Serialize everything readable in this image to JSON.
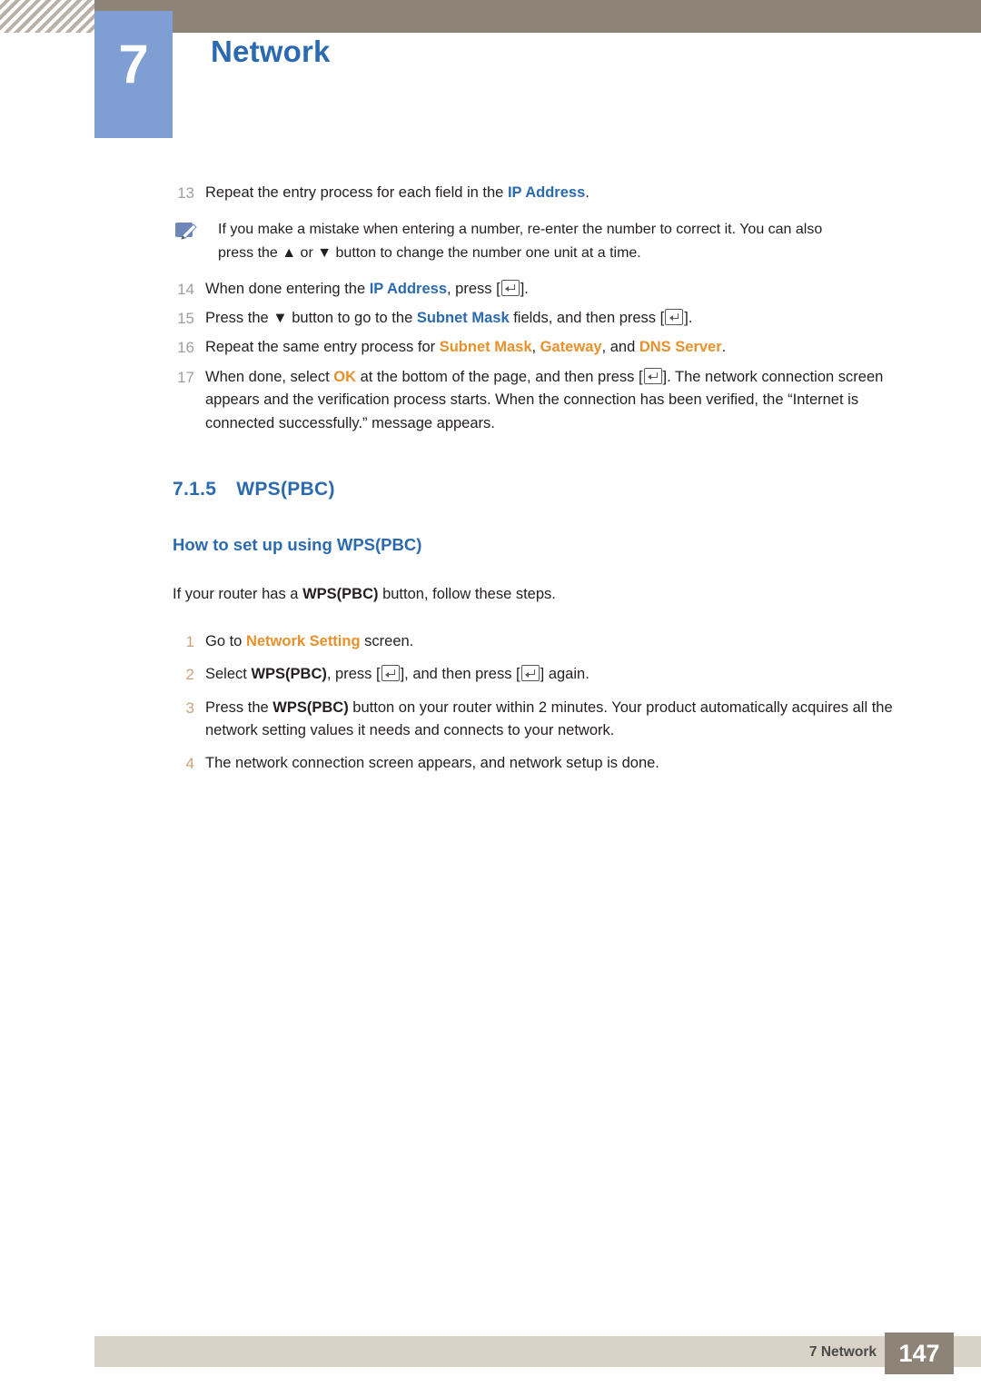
{
  "header": {
    "chapter_number": "7",
    "chapter_title": "Network"
  },
  "steps_top": [
    {
      "num": "13",
      "segments": [
        {
          "t": "Repeat the entry process for each field in the ",
          "s": "plain"
        },
        {
          "t": "IP Address",
          "s": "kw-blue"
        },
        {
          "t": ".",
          "s": "plain"
        }
      ]
    }
  ],
  "note": {
    "icon": "note-pencil-icon",
    "line1": "If you make a mistake when entering a number, re-enter the number to correct it. You can also",
    "line2_a": "press the ",
    "line2_up": "▲",
    "line2_b": " or ",
    "line2_down": "▼",
    "line2_c": " button to change the number one unit at a time."
  },
  "steps_mid": [
    {
      "num": "14",
      "segments": [
        {
          "t": "When done entering the ",
          "s": "plain"
        },
        {
          "t": "IP Address",
          "s": "kw-blue"
        },
        {
          "t": ", press [",
          "s": "plain"
        },
        {
          "t": "",
          "s": "enterkey"
        },
        {
          "t": "].",
          "s": "plain"
        }
      ]
    },
    {
      "num": "15",
      "segments": [
        {
          "t": "Press the ",
          "s": "plain"
        },
        {
          "t": "▼",
          "s": "plain"
        },
        {
          "t": " button to go to the ",
          "s": "plain"
        },
        {
          "t": "Subnet Mask",
          "s": "kw-blue"
        },
        {
          "t": " fields, and then press [",
          "s": "plain"
        },
        {
          "t": "",
          "s": "enterkey"
        },
        {
          "t": "].",
          "s": "plain"
        }
      ]
    },
    {
      "num": "16",
      "segments": [
        {
          "t": "Repeat the same entry process for ",
          "s": "plain"
        },
        {
          "t": "Subnet Mask",
          "s": "kw-orange"
        },
        {
          "t": ", ",
          "s": "plain"
        },
        {
          "t": "Gateway",
          "s": "kw-orange"
        },
        {
          "t": ", and ",
          "s": "plain"
        },
        {
          "t": "DNS Server",
          "s": "kw-orange"
        },
        {
          "t": ".",
          "s": "plain"
        }
      ]
    },
    {
      "num": "17",
      "segments": [
        {
          "t": "When done, select ",
          "s": "plain"
        },
        {
          "t": "OK",
          "s": "kw-orange"
        },
        {
          "t": " at the bottom of the page, and then press [",
          "s": "plain"
        },
        {
          "t": "",
          "s": "enterkey"
        },
        {
          "t": "]. The network connection screen appears and the verification process starts. When the connection has been verified, the “Internet is connected successfully.” message appears.",
          "s": "plain"
        }
      ]
    }
  ],
  "section": {
    "number": "7.1.5",
    "title": "WPS(PBC)",
    "subtitle": "How to set up using WPS(PBC)",
    "intro_segments": [
      {
        "t": "If your router has a ",
        "s": "plain"
      },
      {
        "t": "WPS(PBC)",
        "s": "kw-black"
      },
      {
        "t": " button, follow these steps.",
        "s": "plain"
      }
    ]
  },
  "steps_bottom": [
    {
      "num": "1",
      "segments": [
        {
          "t": "Go to ",
          "s": "plain"
        },
        {
          "t": "Network Setting",
          "s": "kw-orange"
        },
        {
          "t": " screen.",
          "s": "plain"
        }
      ]
    },
    {
      "num": "2",
      "segments": [
        {
          "t": "Select ",
          "s": "plain"
        },
        {
          "t": "WPS(PBC)",
          "s": "kw-black"
        },
        {
          "t": ", press [",
          "s": "plain"
        },
        {
          "t": "",
          "s": "enterkey"
        },
        {
          "t": "], and then press [",
          "s": "plain"
        },
        {
          "t": "",
          "s": "enterkey"
        },
        {
          "t": "] again.",
          "s": "plain"
        }
      ]
    },
    {
      "num": "3",
      "segments": [
        {
          "t": "Press the ",
          "s": "plain"
        },
        {
          "t": "WPS(PBC)",
          "s": "kw-black"
        },
        {
          "t": " button on your router within 2 minutes. Your product automatically acquires all the network setting values it needs and connects to your network.",
          "s": "plain"
        }
      ]
    },
    {
      "num": "4",
      "segments": [
        {
          "t": "The network connection screen appears, and network setup is done.",
          "s": "plain"
        }
      ]
    }
  ],
  "footer": {
    "label": "7 Network",
    "page": "147"
  }
}
